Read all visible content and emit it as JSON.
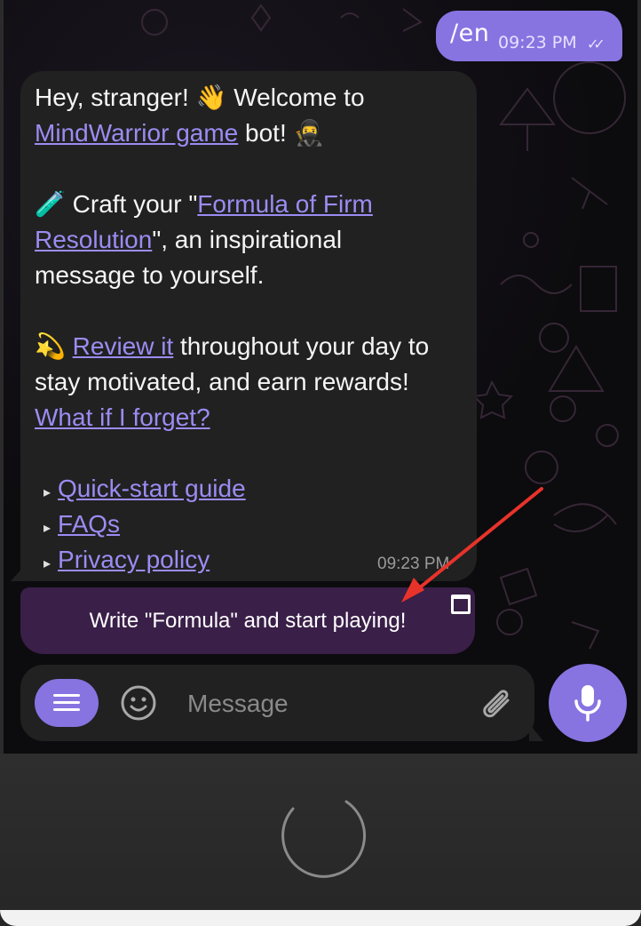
{
  "outgoing_message": {
    "text": "/en",
    "time": "09:23 PM",
    "status_icon": "double-check-icon"
  },
  "incoming_message": {
    "greeting": "Hey, stranger! ",
    "greeting_emoji": "👋",
    "greeting_rest": " Welcome to",
    "game_link": "MindWarrior game",
    "bot_text": " bot! ",
    "bot_emoji": "🥷",
    "craft_emoji": "🧪",
    "craft_prefix": " Craft your \"",
    "formula_link_line1": "Formula of Firm ",
    "formula_link_line2": "Resolution",
    "craft_suffix": "\", an inspirational",
    "craft_line3": "message to yourself.",
    "review_emoji": "💫",
    "review_link": "Review it",
    "review_suffix": " throughout your day to",
    "review_line2": "stay motivated, and earn rewards!",
    "forget_link": "What if I forget?",
    "links": [
      {
        "label": "Quick-start guide"
      },
      {
        "label": "FAQs"
      },
      {
        "label": "Privacy policy"
      }
    ],
    "bullet_glyph": "▸",
    "time": "09:23 PM"
  },
  "inline_keyboard": {
    "button_label": "Write \"Formula\" and start playing!",
    "corner_icon": "window-icon"
  },
  "input_bar": {
    "placeholder": "Message",
    "menu_icon": "menu-icon",
    "emoji_icon": "smile-icon",
    "attach_icon": "paperclip-icon",
    "mic_icon": "microphone-icon"
  },
  "colors": {
    "accent": "#8774e1",
    "bubble": "#212121",
    "link": "#9b8cf2",
    "keyboard_button": "#3a1f48",
    "annotation_arrow": "#e8332a"
  }
}
